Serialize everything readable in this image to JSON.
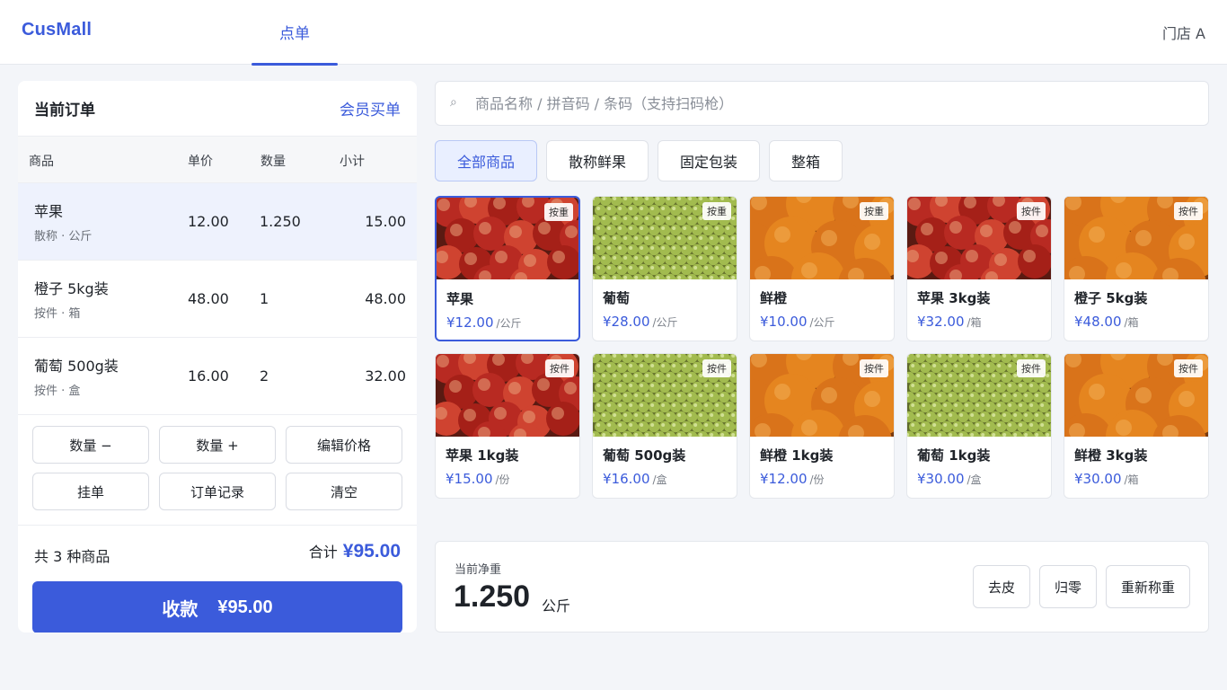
{
  "app": {
    "brand": "CusMall",
    "nav_tab": "点单",
    "store": "门店 A"
  },
  "order": {
    "title": "当前订单",
    "member_link": "会员买单",
    "columns": {
      "name": "商品",
      "price": "单价",
      "qty": "数量",
      "subtotal": "小计"
    },
    "rows": [
      {
        "name": "苹果",
        "meta": "散称 · 公斤",
        "price": "12.00",
        "qty": "1.250",
        "subtotal": "15.00"
      },
      {
        "name": "橙子 5kg装",
        "meta": "按件 · 箱",
        "price": "48.00",
        "qty": "1",
        "subtotal": "48.00"
      },
      {
        "name": "葡萄 500g装",
        "meta": "按件 · 盒",
        "price": "16.00",
        "qty": "2",
        "subtotal": "32.00"
      }
    ],
    "actions": [
      "数量 −",
      "数量 +",
      "编辑价格",
      "挂单",
      "订单记录",
      "清空"
    ],
    "count_text": "共 3 种商品",
    "total_label": "合计",
    "total_value": "¥95.00",
    "pay_label": "收款",
    "pay_amount": "¥95.00"
  },
  "search": {
    "placeholder": "商品名称 / 拼音码 / 条码（支持扫码枪）",
    "icon": "search-icon"
  },
  "categories": [
    "全部商品",
    "散称鲜果",
    "固定包装",
    "整箱"
  ],
  "products": [
    {
      "name": "苹果",
      "price": "¥12.00",
      "unit": "/公斤",
      "tag": "按重",
      "kind": "apple"
    },
    {
      "name": "葡萄",
      "price": "¥28.00",
      "unit": "/公斤",
      "tag": "按重",
      "kind": "grape"
    },
    {
      "name": "鲜橙",
      "price": "¥10.00",
      "unit": "/公斤",
      "tag": "按重",
      "kind": "orange"
    },
    {
      "name": "苹果 3kg装",
      "price": "¥32.00",
      "unit": "/箱",
      "tag": "按件",
      "kind": "apple"
    },
    {
      "name": "橙子 5kg装",
      "price": "¥48.00",
      "unit": "/箱",
      "tag": "按件",
      "kind": "orange"
    },
    {
      "name": "苹果 1kg装",
      "price": "¥15.00",
      "unit": "/份",
      "tag": "按件",
      "kind": "apple"
    },
    {
      "name": "葡萄 500g装",
      "price": "¥16.00",
      "unit": "/盒",
      "tag": "按件",
      "kind": "grape"
    },
    {
      "name": "鲜橙 1kg装",
      "price": "¥12.00",
      "unit": "/份",
      "tag": "按件",
      "kind": "orange"
    },
    {
      "name": "葡萄 1kg装",
      "price": "¥30.00",
      "unit": "/盒",
      "tag": "按件",
      "kind": "grape"
    },
    {
      "name": "鲜橙 3kg装",
      "price": "¥30.00",
      "unit": "/箱",
      "tag": "按件",
      "kind": "orange"
    }
  ],
  "weight": {
    "label": "当前净重",
    "value": "1.250",
    "unit": "公斤",
    "buttons": [
      "去皮",
      "归零",
      "重新称重"
    ]
  },
  "colors": {
    "accent": "#3b5bdb",
    "background": "#f3f5f9",
    "apple": "#c8352b",
    "grape": "#a9c25a",
    "orange": "#e07a1c"
  }
}
